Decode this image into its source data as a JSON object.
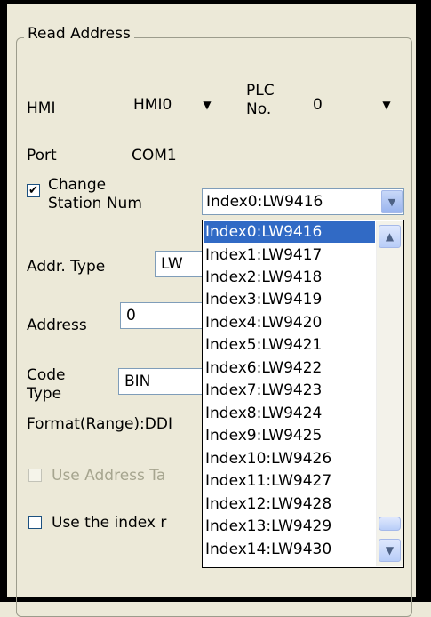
{
  "group": {
    "title": "Read Address"
  },
  "hmi": {
    "label": "HMI",
    "value": "HMI0"
  },
  "plc": {
    "label_line1": "PLC",
    "label_line2": "No.",
    "value": "0"
  },
  "port": {
    "label": "Port",
    "value": "COM1"
  },
  "change_station": {
    "checked": true,
    "label_line1": "Change",
    "label_line2": "Station Num",
    "value": "Index0:LW9416"
  },
  "addr_type": {
    "label": "Addr. Type",
    "value": "LW"
  },
  "address": {
    "label": "Address",
    "value": "0"
  },
  "code_type": {
    "label_line1": "Code",
    "label_line2": "Type",
    "value": "BIN"
  },
  "format": {
    "label": "Format(Range):DDI"
  },
  "use_address_tag": {
    "label": "Use Address Ta",
    "checked": false,
    "enabled": false
  },
  "use_index": {
    "label": "Use the index r",
    "checked": false,
    "enabled": true
  },
  "dropdown": {
    "items": [
      "Index0:LW9416",
      "Index1:LW9417",
      "Index2:LW9418",
      "Index3:LW9419",
      "Index4:LW9420",
      "Index5:LW9421",
      "Index6:LW9422",
      "Index7:LW9423",
      "Index8:LW9424",
      "Index9:LW9425",
      "Index10:LW9426",
      "Index11:LW9427",
      "Index12:LW9428",
      "Index13:LW9429",
      "Index14:LW9430"
    ],
    "selected_index": 0
  },
  "icons": {
    "combo_arrow": "chevron-down-icon",
    "scroll_up": "scroll-up-icon",
    "scroll_down": "scroll-down-icon",
    "check": "checkmark-icon"
  }
}
